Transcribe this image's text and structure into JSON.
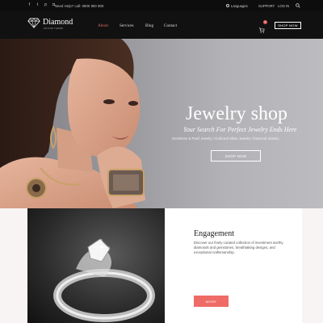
{
  "topbar": {
    "social_icons": [
      "facebook-icon",
      "twitter-icon",
      "pinterest-icon",
      "instagram-icon"
    ],
    "help_text": "Need Help? call: 0900 800 900",
    "language_label": "Languages",
    "support_label": "SUPPORT",
    "login_label": "LOG IN"
  },
  "header": {
    "brand": "Diamond",
    "tagline": "ONLINE THEME",
    "nav": [
      "About",
      "Services",
      "Blog",
      "Contact"
    ],
    "active_nav": "About",
    "cart_count": "0",
    "shop_now_label": "SHOP NOW"
  },
  "hero": {
    "title": "Jewelry shop",
    "subtitle": "Your Search For Perfect Jewelry Ends Here",
    "categories": "Gemstone & Pearl Jewelry / Gold and Silver Jewelry / Diamond Jewelry",
    "button_label": "SHOP NOW"
  },
  "feature": {
    "title": "Engagement",
    "text": "Discover our finely curated collection of investment worthy diamonds and gemstones, breathtaking designs, and exceptional craftsmanship.",
    "button_label": "MORE"
  },
  "colors": {
    "accent": "#ef6b66",
    "nav_active": "#e06a6a",
    "dark_bar": "#111111"
  }
}
